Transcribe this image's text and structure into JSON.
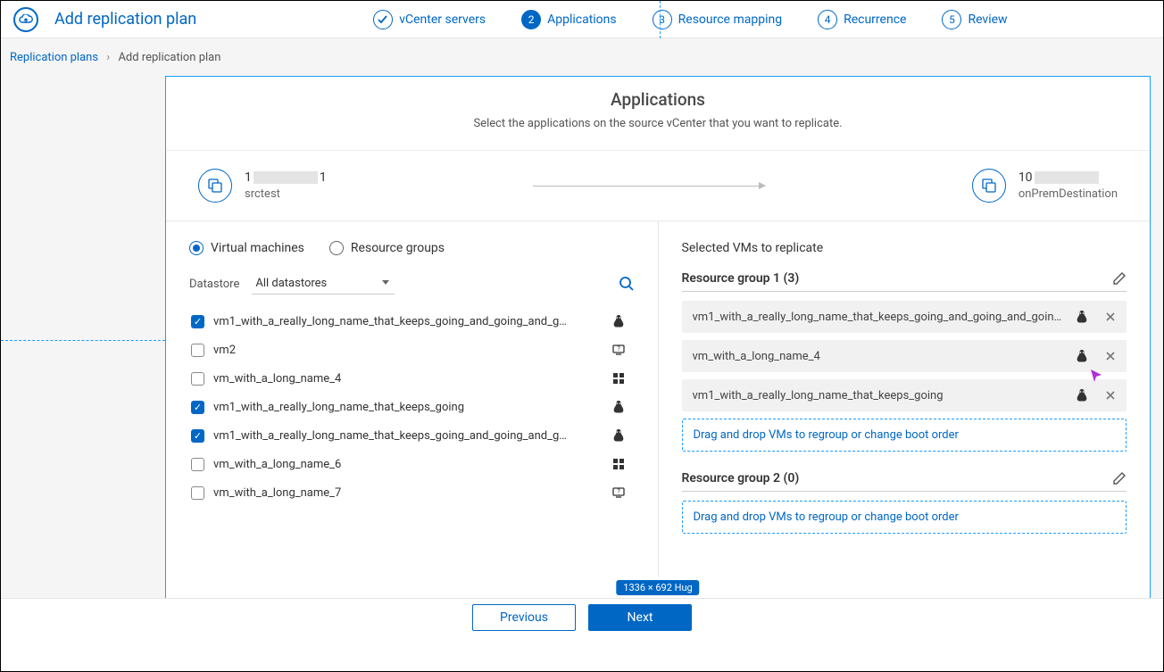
{
  "header": {
    "title": "Add replication plan"
  },
  "steps": [
    {
      "label": "vCenter servers",
      "state": "done"
    },
    {
      "label": "Applications",
      "state": "active",
      "num": "2"
    },
    {
      "label": "Resource mapping",
      "num": "3"
    },
    {
      "label": "Recurrence",
      "num": "4"
    },
    {
      "label": "Review",
      "num": "5"
    }
  ],
  "breadcrumb": {
    "root": "Replication plans",
    "current": "Add replication plan"
  },
  "panel": {
    "title": "Applications",
    "subtitle": "Select the applications on the source vCenter that you want to replicate."
  },
  "source": {
    "ip_prefix": "1",
    "ip_suffix": "1",
    "name": "srctest"
  },
  "dest": {
    "ip_prefix": "10",
    "name": "onPremDestination"
  },
  "radio": {
    "vm": "Virtual machines",
    "rg": "Resource groups"
  },
  "filter": {
    "label": "Datastore",
    "value": "All datastores"
  },
  "vms": [
    {
      "name": "vm1_with_a_really_long_name_that_keeps_going_and_going_and_g…",
      "checked": true,
      "os": "linux"
    },
    {
      "name": "vm2",
      "checked": false,
      "os": "unknown"
    },
    {
      "name": "vm_with_a_long_name_4",
      "checked": false,
      "os": "windows"
    },
    {
      "name": "vm1_with_a_really_long_name_that_keeps_going",
      "checked": true,
      "os": "linux"
    },
    {
      "name": "vm1_with_a_really_long_name_that_keeps_going_and_going_and_g…",
      "checked": true,
      "os": "linux"
    },
    {
      "name": "vm_with_a_long_name_6",
      "checked": false,
      "os": "windows"
    },
    {
      "name": "vm_with_a_long_name_7",
      "checked": false,
      "os": "unknown"
    }
  ],
  "right": {
    "title": "Selected VMs to replicate",
    "groups": [
      {
        "head": "Resource group 1 (3)",
        "items": [
          {
            "name": "vm1_with_a_really_long_name_that_keeps_going_and_going_and_goin…",
            "os": "linux"
          },
          {
            "name": "vm_with_a_long_name_4",
            "os": "linux"
          },
          {
            "name": "vm1_with_a_really_long_name_that_keeps_going",
            "os": "linux"
          }
        ]
      },
      {
        "head": "Resource group 2 (0)",
        "items": []
      }
    ],
    "drop_hint": "Drag and drop VMs to regroup or change boot order"
  },
  "size_tag": "1336 × 692 Hug",
  "footer": {
    "prev": "Previous",
    "next": "Next"
  }
}
